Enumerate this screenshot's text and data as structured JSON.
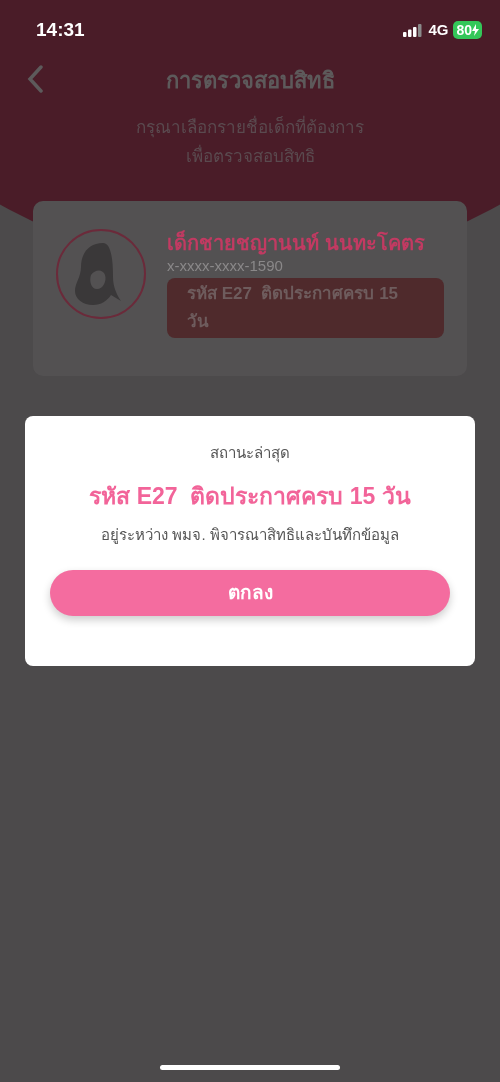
{
  "status_bar": {
    "time": "14:31",
    "network": "4G",
    "battery": "80"
  },
  "header": {
    "title": "การตรวจสอบสิทธิ",
    "subtitle_lines": [
      "กรุณาเลือกรายชื่อเด็กที่ต้องการ",
      "เพื่อตรวจสอบสิทธิ"
    ]
  },
  "children": [
    {
      "name": "เด็กชายชญานนท์ นนทะโคตร",
      "id_number": "x-xxxx-xxxx-1590",
      "status": "รหัส E27  ติดประกาศครบ 15 วัน"
    }
  ],
  "dialog": {
    "label": "สถานะล่าสุด",
    "status": "รหัส E27  ติดประกาศครบ 15 วัน",
    "detail": "อยู่ระหว่าง พมจ. พิจารณาสิทธิและบันทึกข้อมูล",
    "button": "ตกลง"
  }
}
